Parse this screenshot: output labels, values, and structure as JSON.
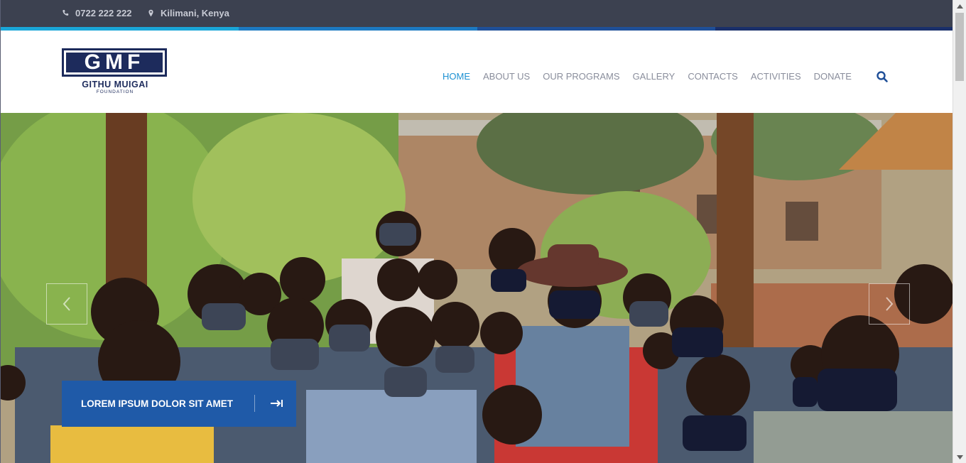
{
  "topbar": {
    "phone": "0722 222 222",
    "location": "Kilimani, Kenya",
    "phone_icon": "phone-icon",
    "location_icon": "map-pin-icon"
  },
  "stripe_colors": [
    "#1aa6d8",
    "#1d7ac2",
    "#1f4f98",
    "#1a2f6a"
  ],
  "brand": {
    "logo_mark": "GMF",
    "logo_name": "GITHU MUIGAI",
    "logo_sub": "FOUNDATION",
    "primary_color": "#1d2b5c"
  },
  "nav": {
    "items": [
      {
        "label": "HOME",
        "active": true
      },
      {
        "label": "ABOUT US",
        "active": false
      },
      {
        "label": "OUR PROGRAMS",
        "active": false
      },
      {
        "label": "GALLERY",
        "active": false
      },
      {
        "label": "CONTACTS",
        "active": false
      },
      {
        "label": "ACTIVITIES",
        "active": false
      },
      {
        "label": "DONATE",
        "active": false
      }
    ],
    "active_color": "#1d91d2",
    "search_icon": "search-icon"
  },
  "hero": {
    "cta_label": "LOREM IPSUM DOLOR SIT AMET",
    "cta_color": "#1f5aa8",
    "cta_icon": "arrow-right-icon",
    "prev_icon": "chevron-left-icon",
    "next_icon": "chevron-right-icon"
  }
}
